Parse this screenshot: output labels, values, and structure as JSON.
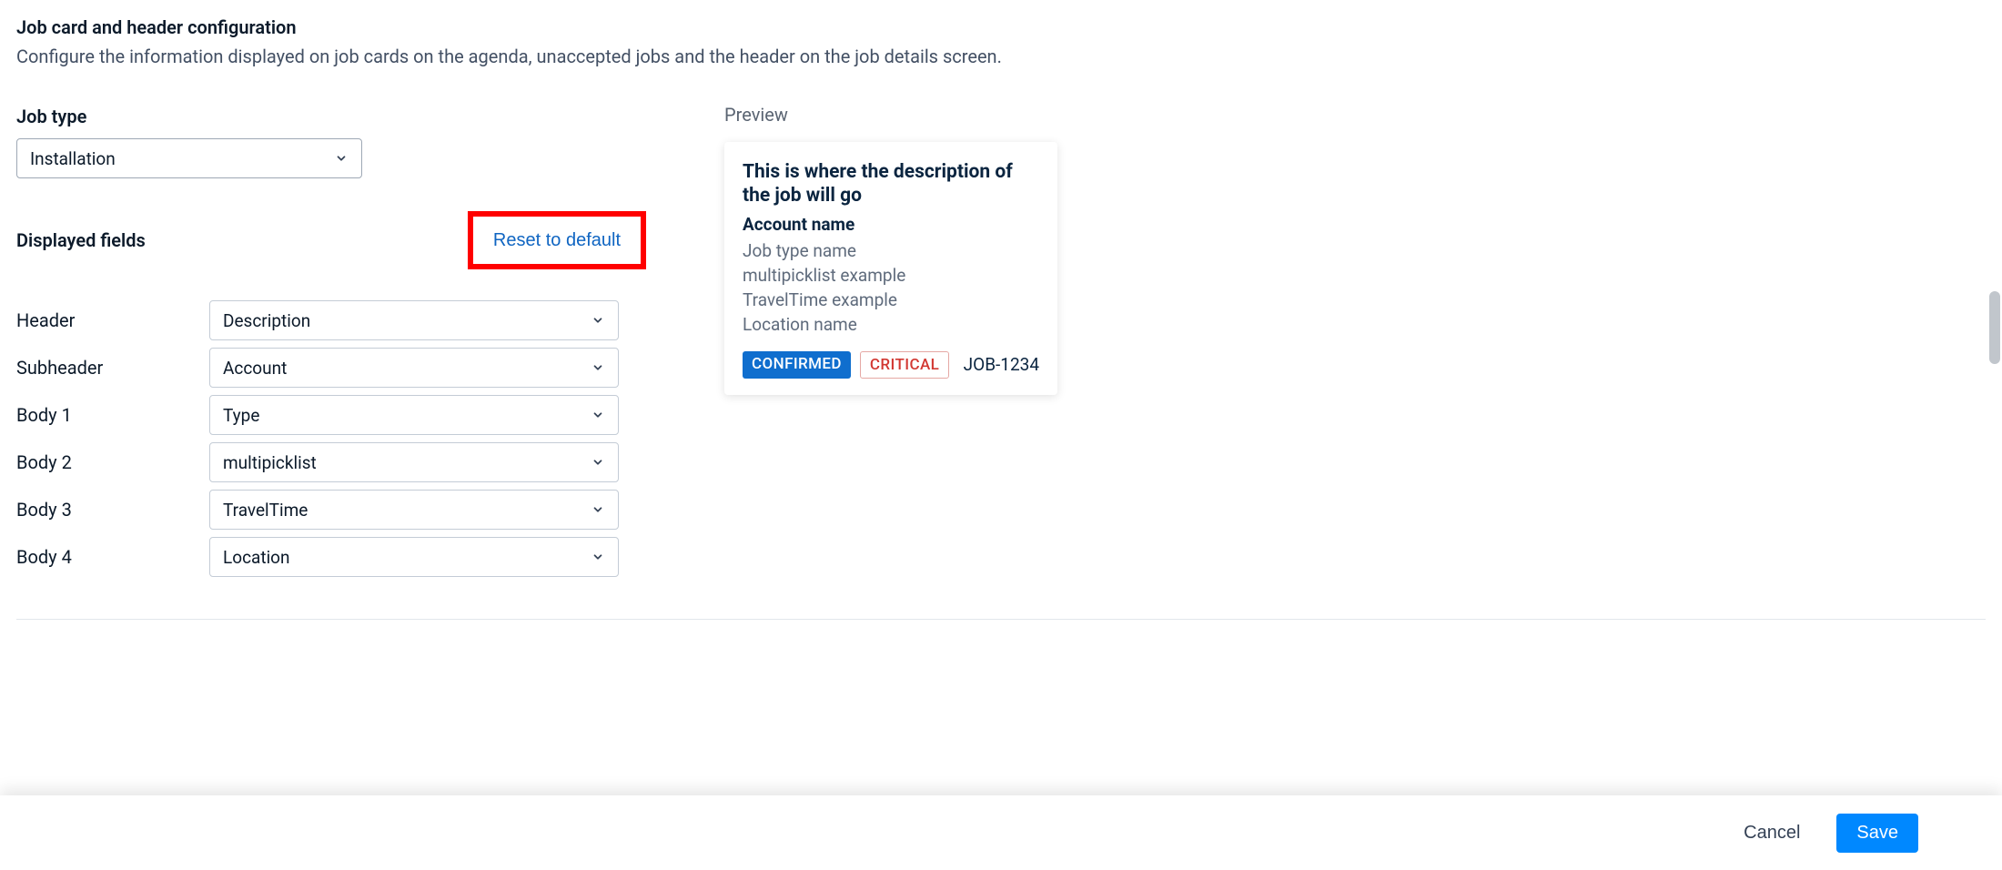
{
  "header": {
    "title": "Job card and header configuration",
    "subtitle": "Configure the information displayed on job cards on the agenda, unaccepted jobs and the header on the job details screen."
  },
  "jobType": {
    "label": "Job type",
    "value": "Installation"
  },
  "fieldsSection": {
    "title": "Displayed fields",
    "resetLabel": "Reset to default",
    "rows": [
      {
        "label": "Header",
        "value": "Description"
      },
      {
        "label": "Subheader",
        "value": "Account"
      },
      {
        "label": "Body 1",
        "value": "Type"
      },
      {
        "label": "Body 2",
        "value": "multipicklist"
      },
      {
        "label": "Body 3",
        "value": "TravelTime"
      },
      {
        "label": "Body 4",
        "value": "Location"
      }
    ]
  },
  "preview": {
    "label": "Preview",
    "title": "This is where the description of the job will go",
    "subtitle": "Account name",
    "lines": [
      "Job type name",
      "multipicklist example",
      "TravelTime example",
      "Location name"
    ],
    "badges": {
      "confirmed": "CONFIRMED",
      "critical": "CRITICAL"
    },
    "jobId": "JOB-1234"
  },
  "footer": {
    "cancel": "Cancel",
    "save": "Save"
  }
}
